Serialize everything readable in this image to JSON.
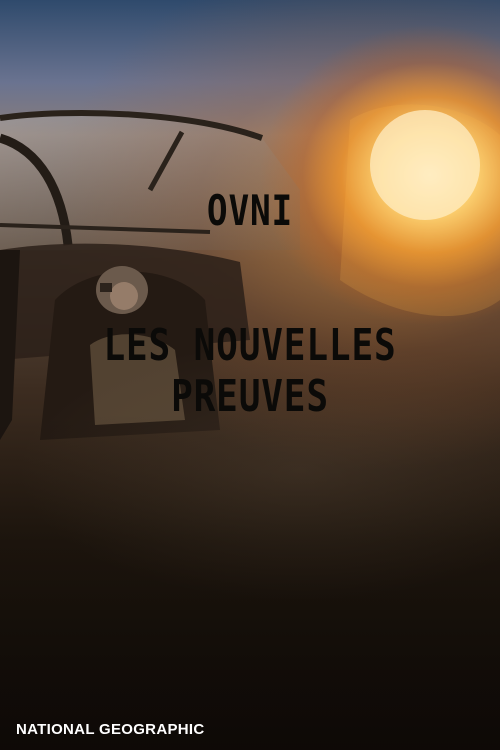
{
  "poster": {
    "title": "OVNI",
    "subtitle": "LES NOUVELLES PREUVES",
    "brand": "NATIONAL GEOGRAPHIC"
  },
  "scene": {
    "elements": [
      "aircraft-canopy",
      "pilot",
      "fireball",
      "sky"
    ],
    "colors": {
      "sky": "#2f4a6c",
      "fireball_core": "#fff6d5",
      "fireball_glow": "#f0962a",
      "title_text": "#0b0a08",
      "brand_text": "#ffffff"
    }
  }
}
